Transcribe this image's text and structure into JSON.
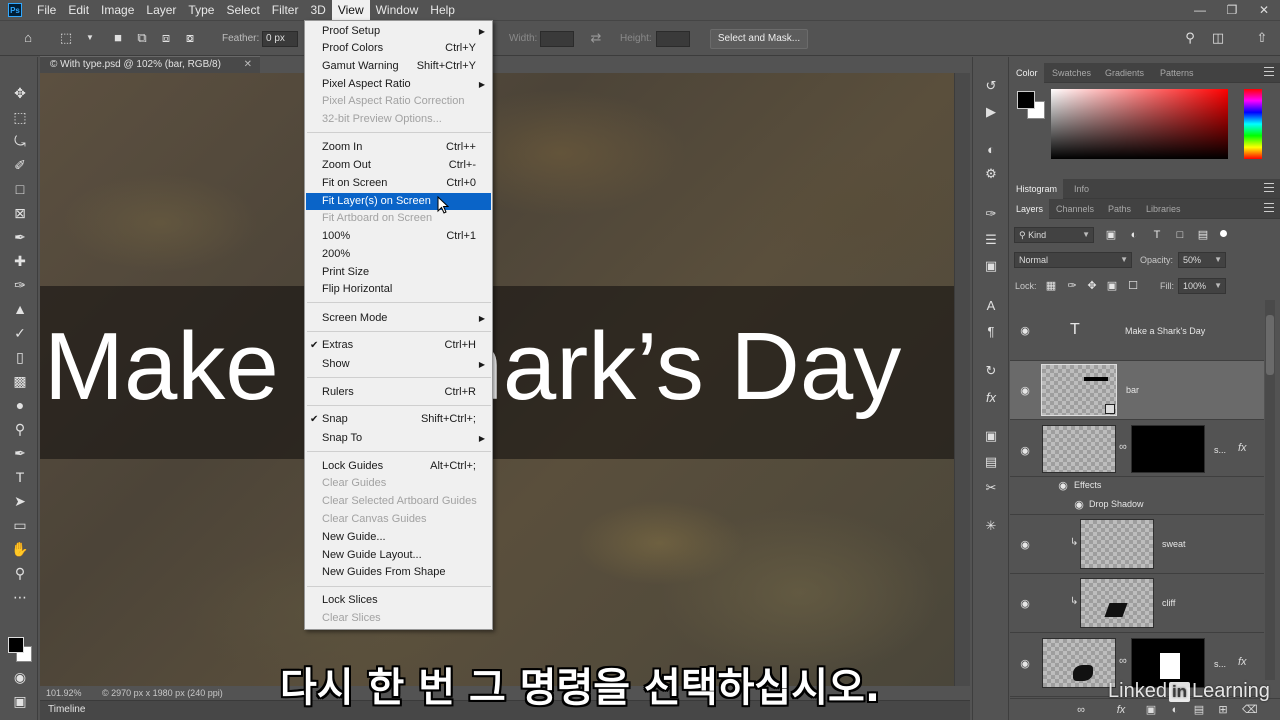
{
  "menubar": {
    "app_icon": "Ps",
    "items": [
      "File",
      "Edit",
      "Image",
      "Layer",
      "Type",
      "Select",
      "Filter",
      "3D",
      "View",
      "Window",
      "Help"
    ],
    "active": "View",
    "window_controls": [
      "minimize-icon",
      "restore-icon",
      "close-icon"
    ]
  },
  "options_bar": {
    "feather_label": "Feather:",
    "feather_value": "0 px",
    "width_label": "Width:",
    "height_label": "Height:",
    "select_mask_label": "Select and Mask..."
  },
  "document": {
    "tab_title": "© With type.psd @ 102% (bar, RGB/8)",
    "canvas_text": "Make a Shark’s Day",
    "status_zoom": "101.92%",
    "status_info": "© 2970 px x 1980 px (240 ppi)",
    "timeline_label": "Timeline"
  },
  "view_menu": {
    "items": [
      {
        "label": "Proof Setup",
        "submenu": true
      },
      {
        "label": "Proof Colors",
        "shortcut": "Ctrl+Y"
      },
      {
        "label": "Gamut Warning",
        "shortcut": "Shift+Ctrl+Y"
      },
      {
        "label": "Pixel Aspect Ratio",
        "submenu": true
      },
      {
        "label": "Pixel Aspect Ratio Correction",
        "disabled": true
      },
      {
        "label": "32-bit Preview Options...",
        "disabled": true
      },
      {
        "label": "Zoom In",
        "shortcut": "Ctrl++"
      },
      {
        "label": "Zoom Out",
        "shortcut": "Ctrl+-"
      },
      {
        "label": "Fit on Screen",
        "shortcut": "Ctrl+0"
      },
      {
        "label": "Fit Layer(s) on Screen",
        "highlighted": true
      },
      {
        "label": "Fit Artboard on Screen",
        "disabled": true
      },
      {
        "label": "100%",
        "shortcut": "Ctrl+1"
      },
      {
        "label": "200%"
      },
      {
        "label": "Print Size"
      },
      {
        "label": "Flip Horizontal"
      },
      {
        "label": "Screen Mode",
        "submenu": true
      },
      {
        "label": "Extras",
        "shortcut": "Ctrl+H",
        "checked": true
      },
      {
        "label": "Show",
        "submenu": true
      },
      {
        "label": "Rulers",
        "shortcut": "Ctrl+R"
      },
      {
        "label": "Snap",
        "shortcut": "Shift+Ctrl+;",
        "checked": true
      },
      {
        "label": "Snap To",
        "submenu": true
      },
      {
        "label": "Lock Guides",
        "shortcut": "Alt+Ctrl+;"
      },
      {
        "label": "Clear Guides",
        "disabled": true
      },
      {
        "label": "Clear Selected Artboard Guides",
        "disabled": true
      },
      {
        "label": "Clear Canvas Guides",
        "disabled": true
      },
      {
        "label": "New Guide..."
      },
      {
        "label": "New Guide Layout..."
      },
      {
        "label": "New Guides From Shape"
      },
      {
        "label": "Lock Slices"
      },
      {
        "label": "Clear Slices",
        "disabled": true
      }
    ]
  },
  "color_panel": {
    "tabs": [
      "Color",
      "Swatches",
      "Gradients",
      "Patterns"
    ],
    "active_tab": "Color",
    "foreground": "#000000",
    "background": "#ffffff",
    "hue": "#ff0000"
  },
  "histogram_panel": {
    "tabs": [
      "Histogram",
      "Info"
    ],
    "active_tab": "Histogram"
  },
  "layers_panel": {
    "tabs": [
      "Layers",
      "Channels",
      "Paths",
      "Libraries"
    ],
    "active_tab": "Layers",
    "filter_kind": "Kind",
    "blend_mode": "Normal",
    "opacity_label": "Opacity:",
    "opacity_value": "50%",
    "lock_label": "Lock:",
    "fill_label": "Fill:",
    "fill_value": "100%",
    "layers": [
      {
        "name": "Make a Shark's Day",
        "kind": "type"
      },
      {
        "name": "bar",
        "selected": true
      },
      {
        "name": "s...",
        "mask": true,
        "fx": true
      },
      {
        "name": "Effects"
      },
      {
        "name": "Drop Shadow"
      },
      {
        "name": "sweat",
        "clipped": true
      },
      {
        "name": "cliff",
        "clipped": true
      },
      {
        "name": "s...",
        "mask": true,
        "fx": true
      }
    ]
  },
  "overlay": {
    "subtitle": "다시 한 번 그 명령을 선택하십시오.",
    "watermark_a": "Linked",
    "watermark_in": "in",
    "watermark_b": "Learning"
  }
}
